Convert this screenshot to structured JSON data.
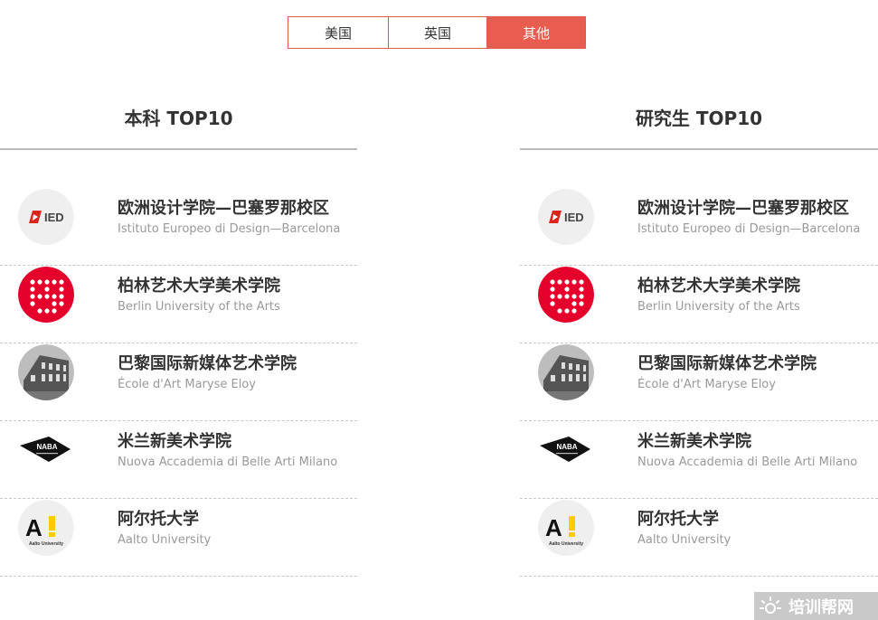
{
  "tabs": [
    {
      "label": "美国",
      "active": false
    },
    {
      "label": "英国",
      "active": false
    },
    {
      "label": "其他",
      "active": true
    }
  ],
  "columns": [
    {
      "title": "本科 TOP10"
    },
    {
      "title": "研究生 TOP10"
    }
  ],
  "schools": [
    {
      "cn": "欧洲设计学院—巴塞罗那校区",
      "en": "Istituto Europeo di Design—Barcelona",
      "logo": "ied-logo",
      "logo_text": "IED"
    },
    {
      "cn": "柏林艺术大学美术学院",
      "en": "Berlin University of the Arts",
      "logo": "udk-berlin-logo",
      "logo_text": ""
    },
    {
      "cn": "巴黎国际新媒体艺术学院",
      "en": "École d'Art Maryse Eloy",
      "logo": "building-photo-logo",
      "logo_text": ""
    },
    {
      "cn": "米兰新美术学院",
      "en": "Nuova Accademia di Belle Arti Milano",
      "logo": "naba-logo",
      "logo_text": "NABA"
    },
    {
      "cn": "阿尔托大学",
      "en": "Aalto University",
      "logo": "aalto-logo",
      "logo_text": "A!",
      "logo_subtext": "Aalto University"
    }
  ],
  "watermark": {
    "text": "培训帮网",
    "icon": "sun-icon"
  },
  "colors": {
    "accent": "#e85d50",
    "udk_red": "#e4002b",
    "aalto_yellow": "#ffcc00"
  }
}
